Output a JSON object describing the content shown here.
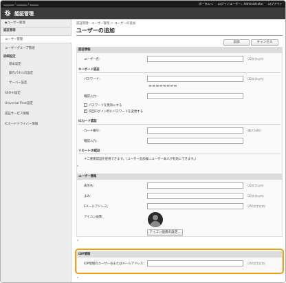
{
  "topbar": {
    "url": "▂▂▂▂▂ / ▂▂▂▂▂ / ▂▂▂▂",
    "portal": "ポータルへ",
    "login_user": "ログインユーザー：Administrator",
    "logout": "ログアウト"
  },
  "header": {
    "title": "認証管理"
  },
  "sidebar": {
    "back": "◆ユーザー管理",
    "section_auth": "認証管理",
    "user_mgmt": "ユーザー管理",
    "group_mgmt": "ユーザーグループ管理",
    "section_advanced": "詳細設定",
    "basic": "基本設定",
    "panel": "操作パネルの設定",
    "server": "サーバー設定",
    "sso": "SSO-H設定",
    "universal_print": "Universal Print設定",
    "auth_service": "認証サービス情報",
    "ic_driver": "ICカードドライバー情報"
  },
  "main": {
    "breadcrumb": "認証管理：ユーザー管理 ＞ ユーザーの追加",
    "title": "ユーザーの追加",
    "add_button": "追加",
    "cancel_button": "キャンセル",
    "auth_info": {
      "header": "認証情報",
      "username_label": "ユーザー名：",
      "username_hint": "（32文字以内）",
      "keyboard_auth": "キーボード認証",
      "password_label": "パスワード：",
      "password_hint": "（32文字以内）",
      "password_mask": "▬▬▬▬▬▬▬▬",
      "confirm_label": "確認入力：",
      "disable_password": "パスワードを無効にする",
      "change_next_login": "次回ログイン時にパスワードを変更する",
      "change_next_login_checked": true,
      "ic_auth": "ICカード認証",
      "card_number_label": "カード番号：",
      "card_number_hint": "（最大16桁）",
      "card_confirm_label": "確認入力：",
      "remote_ui_auth": "リモートUI認証",
      "two_factor_note": "＊二要素認証を使用できます。（ユーザー追加後にユーザー本人が有効にできます。）"
    },
    "collapse_1": "⌃",
    "user_info": {
      "header": "ユーザー情報",
      "display_name_label": "表示名：",
      "display_name_hint": "（32文字以内）",
      "reading_label": "よみ：",
      "reading_hint": "（32文字以内）",
      "email_label": "Eメールアドレス：",
      "email_hint": "（256文字以内）",
      "icon_label": "アイコン画像：",
      "icon_button": "アイコン画像の設定..."
    },
    "collapse_2": "⌃",
    "idp_info": {
      "header": "IDP情報",
      "idp_label": "IDP情報のユーザー名またはメールアドレス：",
      "idp_hint": "（256文字以内）"
    },
    "collapse_3": "⌃"
  },
  "colors": {
    "topbar": "#1b1b1b",
    "header": "#3b3b3b",
    "highlight": "#f0a010"
  }
}
